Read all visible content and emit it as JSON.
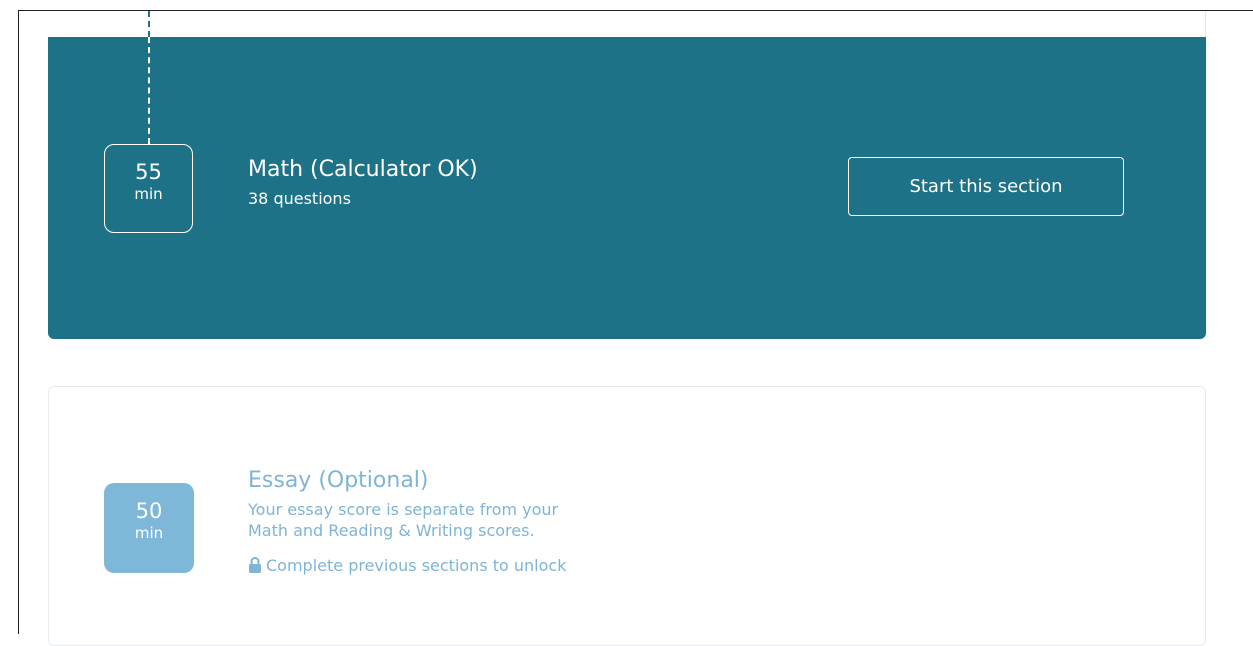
{
  "colors": {
    "active_card": "#1e7288",
    "locked_box": "#7fb7d8",
    "locked_text": "#7fb4d6",
    "white": "#ffffff"
  },
  "sections": {
    "active": {
      "time_value": "55",
      "time_unit": "min",
      "title": "Math (Calculator OK)",
      "subtitle": "38 questions",
      "button_label": "Start this section"
    },
    "locked": {
      "time_value": "50",
      "time_unit": "min",
      "title": "Essay (Optional)",
      "description_line1": "Your essay score is separate from your",
      "description_line2": "Math and Reading & Writing scores.",
      "unlock_note": "Complete previous sections to unlock",
      "icon": "lock-icon"
    }
  }
}
